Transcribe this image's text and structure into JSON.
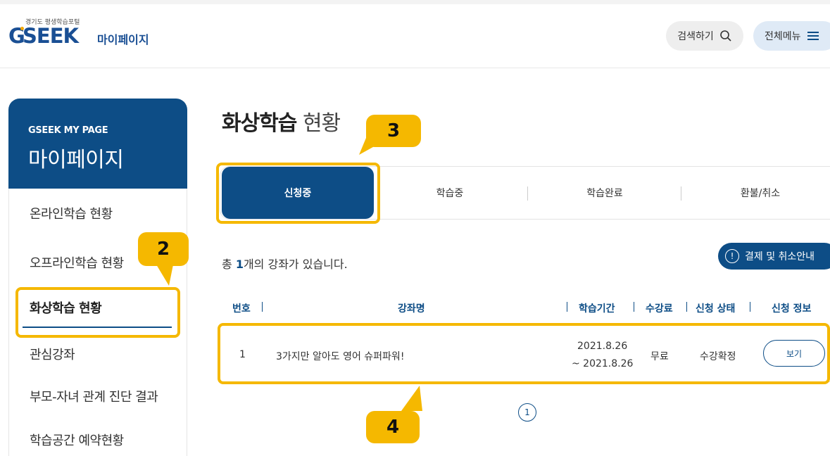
{
  "header": {
    "logo_small": "경기도 평생학습포털",
    "logo_g": "G",
    "logo_text": "SEEK",
    "logo_mypage": "마이페이지",
    "search_label": "검색하기",
    "menu_label": "전체메뉴"
  },
  "sidebar": {
    "subtitle": "GSEEK MY PAGE",
    "title": "마이페이지",
    "items": [
      {
        "label": "온라인학습 현황"
      },
      {
        "label": "오프라인학습 현황"
      },
      {
        "label": "화상학습 현황"
      },
      {
        "label": "관심강좌"
      },
      {
        "label": "부모-자녀 관계 진단 결과"
      },
      {
        "label": "학습공간 예약현황"
      }
    ]
  },
  "main": {
    "title_bold": "화상학습",
    "title_light": "현황",
    "tabs": [
      {
        "label": "신청중"
      },
      {
        "label": "학습중"
      },
      {
        "label": "학습완료"
      },
      {
        "label": "환불/취소"
      }
    ],
    "count_prefix": "총 ",
    "count_num": "1",
    "count_suffix": "개의 강좌가 있습니다.",
    "refund_button": "결제 및 취소안내",
    "columns": [
      "번호",
      "강좌명",
      "학습기간",
      "수강료",
      "신청 상태",
      "신청 정보"
    ],
    "rows": [
      {
        "num": "1",
        "name": "3가지만 알아도 영어 슈퍼파워!",
        "period_start": "2021.8.26",
        "period_end": "~ 2021.8.26",
        "fee": "무료",
        "status": "수강확정",
        "action": "보기"
      }
    ],
    "page": "1"
  },
  "annotations": [
    "2",
    "3",
    "4"
  ],
  "colors": {
    "primary": "#0d4d86",
    "accent": "#f5b800"
  }
}
